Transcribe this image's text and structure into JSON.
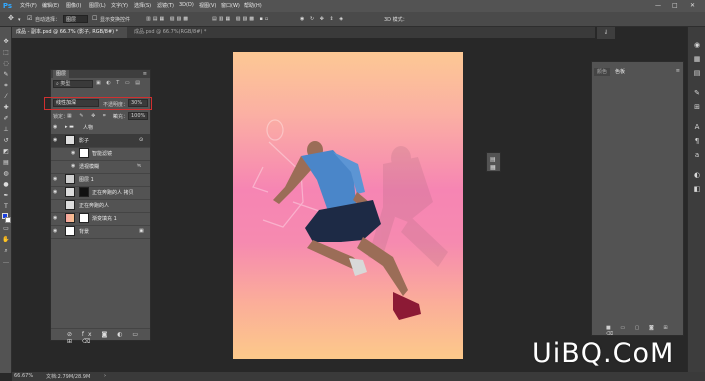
{
  "app": {
    "logo": "Ps"
  },
  "menu": [
    "文件(F)",
    "编辑(E)",
    "图像(I)",
    "图层(L)",
    "文字(Y)",
    "选择(S)",
    "滤镜(T)",
    "3D(D)",
    "视图(V)",
    "窗口(W)",
    "帮助(H)"
  ],
  "window_controls": {
    "minimize": "—",
    "maximize": "□",
    "close": "✕"
  },
  "options_bar": {
    "auto_select_label": "自动选择：",
    "auto_select_value": "图层",
    "show_transform_label": "显示变换控件"
  },
  "tabs": [
    {
      "label": "成品 - 副本.psd @ 66.7% (影子, RGB/8#) *",
      "active": true
    },
    {
      "label": "成品.psd @ 66.7%(RGB/8#) *",
      "active": false
    }
  ],
  "layers_panel": {
    "title": "图层",
    "filter_label": "类型",
    "blend_mode": "线性加深",
    "opacity_label": "不透明度：",
    "opacity_value": "30%",
    "lock_label": "锁定：",
    "fill_label": "填充：",
    "fill_value": "100%",
    "layers": [
      {
        "name": "人物",
        "type": "group"
      },
      {
        "name": "影子",
        "type": "smart",
        "selected": true
      },
      {
        "name": "智能滤镜",
        "type": "filter"
      },
      {
        "name": "透视模糊",
        "type": "filter-item"
      },
      {
        "name": "图层 1",
        "type": "layer"
      },
      {
        "name": "正在奔跑的人 拷贝",
        "type": "layer"
      },
      {
        "name": "正在奔跑的人",
        "type": "layer"
      },
      {
        "name": "渐变填充 1",
        "type": "fill"
      },
      {
        "name": "背景",
        "type": "background"
      }
    ]
  },
  "right_panel": {
    "tabs": [
      "颜色",
      "色板"
    ]
  },
  "status_bar": {
    "zoom": "66.67%",
    "doc": "文档:2.79M/28.9M"
  },
  "watermark": "UiBQ.CoM",
  "colors": {
    "accent": "#31a8ff",
    "highlight_border": "#d03030"
  }
}
